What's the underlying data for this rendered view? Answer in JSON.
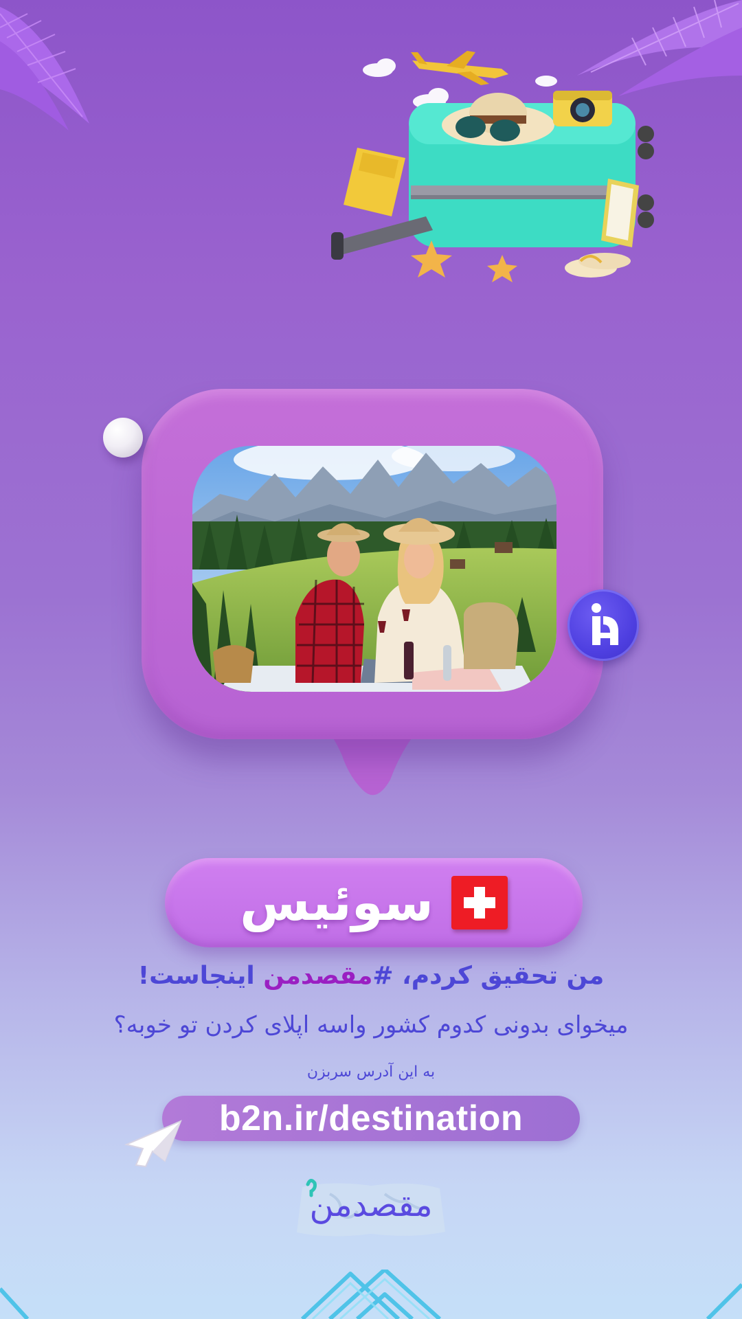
{
  "country": {
    "name": "سوئیس",
    "flag_icon": "swiss-flag-icon"
  },
  "headline": {
    "part1": "من تحقیق کردم، ",
    "hash": "#",
    "tag": "مقصدمن",
    "part2": " اینجاست!"
  },
  "question": "میخوای بدونی کدوم کشور واسه اپلای کردن تو خوبه؟",
  "cta_hint": "به این آدرس سربزن",
  "url": "b2n.ir/destination",
  "logo": {
    "text": "مقصدمن"
  },
  "colors": {
    "accent_text": "#4d47d6",
    "tag_text": "#9a1fc2",
    "bubble": "#bb67d4",
    "pill": "#c878ec",
    "brand_badge": "#4e3fe0",
    "flag_red": "#ee1c25"
  }
}
